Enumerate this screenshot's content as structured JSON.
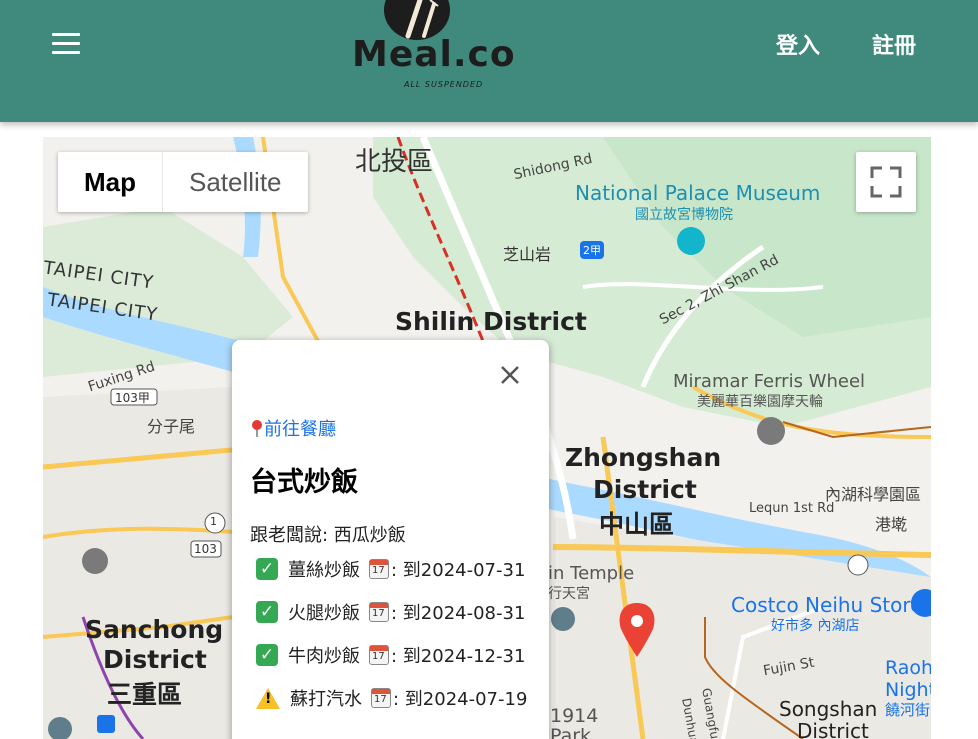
{
  "header": {
    "logo_text": "Meal.co",
    "logo_subtitle": "ALL SUSPENDED",
    "login_label": "登入",
    "register_label": "註冊",
    "background_color": "#3f8a7c"
  },
  "map": {
    "type_buttons": {
      "map": "Map",
      "satellite": "Satellite"
    },
    "selected_type": "Map",
    "labels": [
      {
        "text": "北投區"
      },
      {
        "text": "Shidong Rd"
      },
      {
        "text": "National Palace Museum"
      },
      {
        "text": "國立故宮博物院"
      },
      {
        "text": "芝山岩"
      },
      {
        "text": "2甲"
      },
      {
        "text": "Sec 2, Zhi Shan Rd"
      },
      {
        "text": "TAIPEI CITY"
      },
      {
        "text": "TAIPEI CITY"
      },
      {
        "text": "Shilin District"
      },
      {
        "text": "Fuxing Rd"
      },
      {
        "text": "103甲"
      },
      {
        "text": "分子尾"
      },
      {
        "text": "Miramar Ferris Wheel"
      },
      {
        "text": "美麗華百樂園摩天輪"
      },
      {
        "text": "Zhongshan"
      },
      {
        "text": "District"
      },
      {
        "text": "中山區"
      },
      {
        "text": "內湖科學園區"
      },
      {
        "text": "Lequn 1st Rd"
      },
      {
        "text": "港墘"
      },
      {
        "text": "1"
      },
      {
        "text": "103"
      },
      {
        "text": "Sanchong"
      },
      {
        "text": "District"
      },
      {
        "text": "三重區"
      },
      {
        "text": "in Temple"
      },
      {
        "text": "行天宮"
      },
      {
        "text": "Costco Neihu Store"
      },
      {
        "text": "好市多 內湖店"
      },
      {
        "text": "Fujin St"
      },
      {
        "text": "Songshan"
      },
      {
        "text": "District"
      },
      {
        "text": "Raoh"
      },
      {
        "text": "Night"
      },
      {
        "text": "饒河街"
      },
      {
        "text": "1914"
      },
      {
        "text": "Park"
      },
      {
        "text": "Guangfu N Rd"
      },
      {
        "text": "Dunhua"
      }
    ]
  },
  "info_window": {
    "link_label": "前往餐廳",
    "pin_icon": "round-pushpin",
    "title": "台式炒飯",
    "boss_says": "跟老闆說: 西瓜炒飯",
    "items": [
      {
        "status": "available",
        "status_icon": "check-mark-button",
        "name": "薑絲炒飯",
        "calendar_icon": "calendar",
        "until": ": 到2024-07-31"
      },
      {
        "status": "available",
        "status_icon": "check-mark-button",
        "name": "火腿炒飯",
        "calendar_icon": "calendar",
        "until": ": 到2024-08-31"
      },
      {
        "status": "available",
        "status_icon": "check-mark-button",
        "name": "牛肉炒飯",
        "calendar_icon": "calendar",
        "until": ": 到2024-12-31"
      },
      {
        "status": "warning",
        "status_icon": "warning",
        "name": "蘇打汽水",
        "calendar_icon": "calendar",
        "until": ": 到2024-07-19"
      }
    ]
  },
  "colors": {
    "marker": "#ea4335",
    "link": "#1a73e8",
    "park": "#c8e6c9",
    "water": "#aadaff",
    "road_major": "#f9c855"
  }
}
